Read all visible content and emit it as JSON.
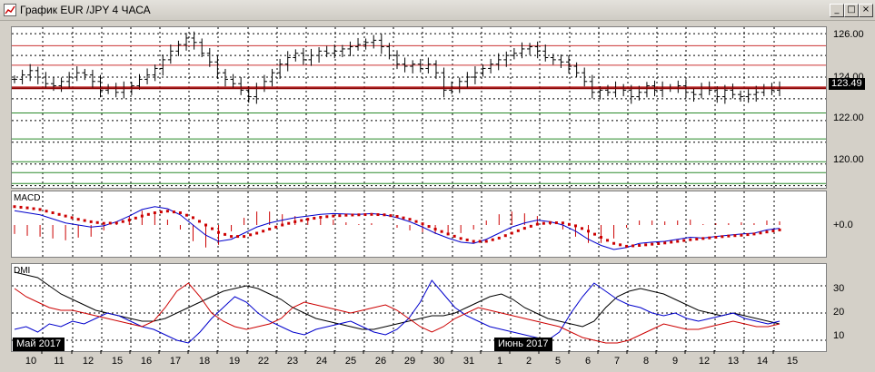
{
  "window": {
    "title": "График EUR /JPY  4 ЧАСА",
    "minimize_glyph": "_",
    "maximize_glyph": "□",
    "close_glyph": "×"
  },
  "price_panel": {
    "y_labels": [
      "126.00",
      "124.00",
      "122.00",
      "120.00"
    ],
    "current_price": "123.49",
    "colors": {
      "bar": "#000000",
      "resistance": "#cc3333",
      "support": "#2a8a2a",
      "price_line": "#8b0000"
    },
    "resistance_levels": [
      125.45,
      124.55,
      123.55
    ],
    "support_levels": [
      122.35,
      121.15,
      120.1,
      119.6,
      119.1
    ]
  },
  "macd_panel": {
    "label": "MACD",
    "zero_label": "+0.0",
    "colors": {
      "macd": "#0000cc",
      "signal": "#cc0000",
      "histogram": "#cc0000"
    }
  },
  "dmi_panel": {
    "label": "DMI",
    "y_labels": [
      "30",
      "20",
      "10"
    ],
    "colors": {
      "adx": "#000000",
      "plus_di": "#0000cc",
      "minus_di": "#cc0000"
    }
  },
  "date_markers": {
    "may": "Май 2017",
    "june": "Июнь 2017"
  },
  "x_axis_labels": [
    "10",
    "11",
    "12",
    "15",
    "16",
    "17",
    "18",
    "19",
    "22",
    "23",
    "24",
    "25",
    "26",
    "29",
    "30",
    "31",
    "1",
    "2",
    "5",
    "6",
    "7",
    "8",
    "9",
    "12",
    "13",
    "14",
    "15"
  ],
  "chart_data": [
    {
      "type": "candlestick",
      "title": "График EUR /JPY  4 ЧАСА",
      "ylim": [
        118.9,
        126.3
      ],
      "close": [
        123.9,
        124.1,
        124.3,
        124.0,
        123.7,
        123.6,
        123.8,
        124.0,
        124.2,
        124.1,
        123.8,
        123.4,
        123.5,
        123.3,
        123.5,
        123.6,
        123.9,
        124.1,
        124.4,
        124.8,
        125.2,
        125.5,
        125.8,
        125.6,
        125.1,
        124.7,
        124.2,
        123.9,
        123.7,
        123.4,
        123.1,
        123.5,
        123.8,
        124.2,
        124.6,
        124.9,
        125.1,
        124.8,
        125.0,
        125.2,
        125.1,
        125.2,
        125.3,
        125.4,
        125.5,
        125.6,
        125.7,
        125.4,
        125.0,
        124.6,
        124.5,
        124.6,
        124.4,
        124.6,
        124.2,
        123.4,
        123.5,
        123.8,
        124.0,
        124.2,
        124.4,
        124.6,
        124.8,
        125.0,
        125.1,
        125.3,
        125.4,
        125.2,
        124.9,
        124.8,
        124.7,
        124.5,
        124.2,
        123.8,
        123.3,
        123.4,
        123.3,
        123.5,
        123.4,
        123.1,
        123.3,
        123.6,
        123.4,
        123.5,
        123.5,
        123.6,
        123.3,
        123.2,
        123.5,
        123.4,
        123.1,
        123.4,
        123.2,
        123.1,
        123.2,
        123.3,
        123.5,
        123.4,
        123.5
      ]
    },
    {
      "type": "line",
      "label": "MACD",
      "series": [
        {
          "name": "MACD",
          "values": [
            0.35,
            0.3,
            0.25,
            0.15,
            0.05,
            0.0,
            -0.05,
            -0.02,
            0.08,
            0.22,
            0.38,
            0.45,
            0.4,
            0.25,
            0.0,
            -0.25,
            -0.4,
            -0.35,
            -0.2,
            -0.05,
            0.05,
            0.12,
            0.18,
            0.22,
            0.26,
            0.28,
            0.27,
            0.26,
            0.28,
            0.25,
            0.18,
            0.08,
            -0.05,
            -0.2,
            -0.32,
            -0.42,
            -0.45,
            -0.35,
            -0.2,
            -0.05,
            0.05,
            0.12,
            0.08,
            0.0,
            -0.15,
            -0.35,
            -0.5,
            -0.6,
            -0.55,
            -0.45,
            -0.42,
            -0.4,
            -0.35,
            -0.3,
            -0.32,
            -0.28,
            -0.25,
            -0.22,
            -0.2,
            -0.12,
            -0.08
          ]
        },
        {
          "name": "Signal",
          "values": [
            0.45,
            0.42,
            0.38,
            0.3,
            0.22,
            0.14,
            0.08,
            0.04,
            0.05,
            0.12,
            0.22,
            0.3,
            0.34,
            0.3,
            0.18,
            0.0,
            -0.18,
            -0.28,
            -0.28,
            -0.2,
            -0.1,
            0.0,
            0.08,
            0.14,
            0.19,
            0.22,
            0.24,
            0.25,
            0.26,
            0.25,
            0.21,
            0.14,
            0.03,
            -0.1,
            -0.22,
            -0.33,
            -0.4,
            -0.4,
            -0.32,
            -0.2,
            -0.08,
            0.02,
            0.06,
            0.05,
            -0.02,
            -0.15,
            -0.3,
            -0.45,
            -0.52,
            -0.5,
            -0.47,
            -0.44,
            -0.4,
            -0.36,
            -0.33,
            -0.3,
            -0.27,
            -0.25,
            -0.22,
            -0.17,
            -0.12
          ]
        }
      ]
    },
    {
      "type": "line",
      "label": "DMI",
      "ylim": [
        6,
        38
      ],
      "series": [
        {
          "name": "ADX",
          "values": [
            35,
            34,
            33,
            30,
            27,
            25,
            23,
            21,
            20,
            19,
            18,
            17,
            17,
            18,
            20,
            22,
            24,
            26,
            28,
            29,
            30,
            29,
            27,
            25,
            22,
            20,
            18,
            17,
            16,
            15,
            14,
            14,
            15,
            16,
            17,
            18,
            19,
            19,
            20,
            22,
            24,
            26,
            27,
            25,
            22,
            20,
            18,
            17,
            16,
            15,
            17,
            22,
            26,
            28,
            29,
            28,
            27,
            25,
            23,
            21,
            20,
            19,
            20,
            19,
            18,
            17,
            16
          ]
        },
        {
          "name": "+DI",
          "values": [
            14,
            15,
            13,
            16,
            15,
            17,
            16,
            18,
            20,
            19,
            17,
            15,
            14,
            12,
            10,
            9,
            13,
            18,
            22,
            26,
            24,
            20,
            17,
            15,
            13,
            12,
            14,
            15,
            16,
            17,
            15,
            13,
            12,
            14,
            18,
            24,
            32,
            27,
            22,
            19,
            17,
            15,
            14,
            13,
            12,
            11,
            10,
            13,
            20,
            26,
            31,
            28,
            25,
            23,
            22,
            20,
            19,
            20,
            18,
            17,
            18,
            19,
            20,
            18,
            17,
            16,
            17
          ]
        },
        {
          "name": "-DI",
          "values": [
            29,
            26,
            24,
            22,
            21,
            21,
            20,
            19,
            18,
            17,
            16,
            15,
            17,
            22,
            28,
            31,
            26,
            20,
            17,
            15,
            14,
            15,
            16,
            18,
            22,
            24,
            23,
            22,
            21,
            20,
            21,
            22,
            23,
            21,
            18,
            15,
            13,
            15,
            18,
            20,
            22,
            21,
            20,
            19,
            18,
            17,
            16,
            15,
            13,
            11,
            10,
            9,
            9,
            10,
            12,
            14,
            16,
            15,
            14,
            14,
            15,
            16,
            17,
            16,
            15,
            15,
            16
          ]
        }
      ]
    }
  ]
}
